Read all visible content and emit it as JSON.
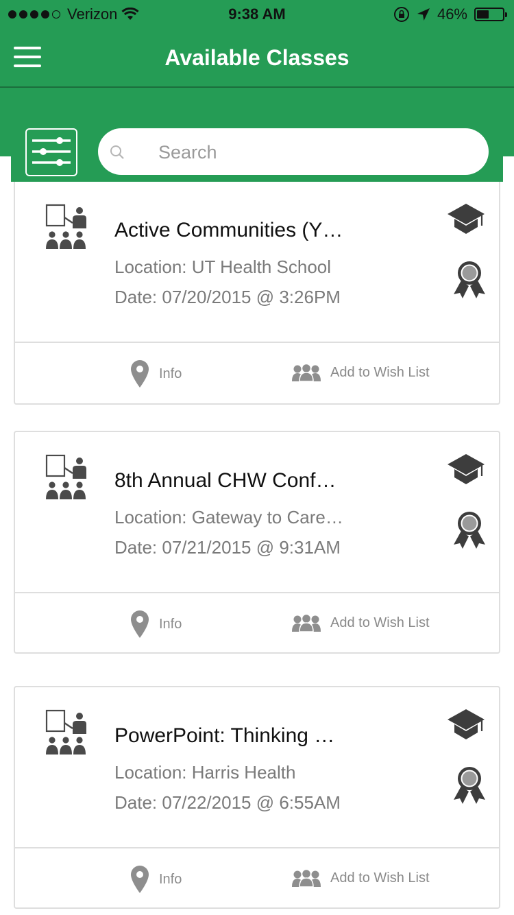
{
  "status_bar": {
    "carrier": "Verizon",
    "time": "9:38 AM",
    "battery_text": "46%",
    "battery_level": 0.46,
    "signal_bars_filled": 4,
    "signal_bars_total": 5
  },
  "header": {
    "title": "Available Classes",
    "background_color": "#259C55"
  },
  "search": {
    "placeholder": "Search",
    "value": ""
  },
  "icons": {
    "menu": "hamburger-menu-icon",
    "filter": "sliders-filter-icon",
    "search": "magnifier-icon",
    "class": "classroom-presentation-icon",
    "certificate": "graduation-cap-icon",
    "award": "award-ribbon-icon",
    "info": "map-pin-icon",
    "wish": "group-users-icon"
  },
  "classes": [
    {
      "title": "Active Communities (Y…",
      "location": "Location: UT Health School",
      "date": "Date: 07/20/2015 @ 3:26PM",
      "info_label": "Info",
      "wish_label": "Add to Wish List"
    },
    {
      "title": "8th Annual CHW Conf…",
      "location": "Location: Gateway to Care…",
      "date": "Date: 07/21/2015 @ 9:31AM",
      "info_label": "Info",
      "wish_label": "Add to Wish List"
    },
    {
      "title": "PowerPoint: Thinking …",
      "location": "Location: Harris Health",
      "date": "Date: 07/22/2015 @ 6:55AM",
      "info_label": "Info",
      "wish_label": "Add to Wish List"
    }
  ]
}
